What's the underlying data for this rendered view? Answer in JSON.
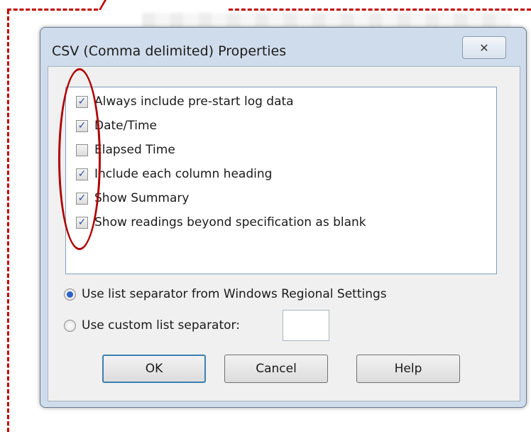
{
  "dialog": {
    "title": "CSV (Comma delimited) Properties",
    "close_glyph": "✕"
  },
  "options": [
    {
      "label": "Always include pre-start log data",
      "checked": true
    },
    {
      "label": "Date/Time",
      "checked": true
    },
    {
      "label": "Elapsed Time",
      "checked": false
    },
    {
      "label": "Include each column heading",
      "checked": true
    },
    {
      "label": "Show Summary",
      "checked": true
    },
    {
      "label": "Show readings beyond specification as blank",
      "checked": true
    }
  ],
  "separator": {
    "windows_label": "Use list separator from Windows Regional Settings",
    "windows_selected": true,
    "custom_label": "Use custom list separator:",
    "custom_selected": false,
    "custom_value": ""
  },
  "buttons": {
    "ok": "OK",
    "cancel": "Cancel",
    "help": "Help"
  },
  "check_glyph": "✓",
  "colors": {
    "annotation": "#c00000",
    "check": "#2f4f9f",
    "radio_dot": "#2f62c7"
  }
}
